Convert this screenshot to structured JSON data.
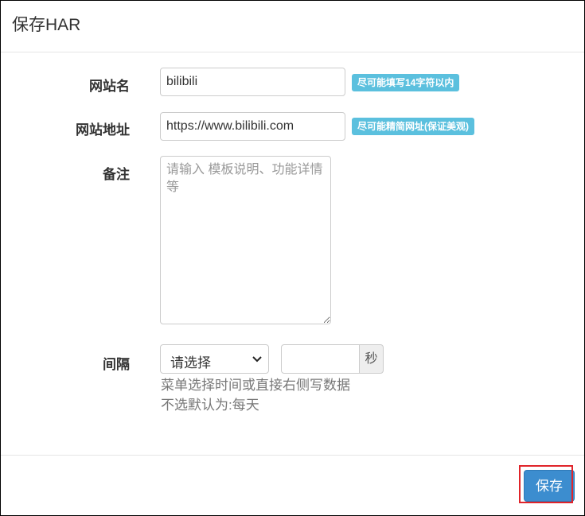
{
  "dialog": {
    "title": "保存HAR"
  },
  "form": {
    "site_name": {
      "label": "网站名",
      "value": "bilibili",
      "hint": "尽可能填写14字符以内"
    },
    "site_url": {
      "label": "网站地址",
      "value": "https://www.bilibili.com",
      "hint": "尽可能精简网址(保证美观)"
    },
    "remark": {
      "label": "备注",
      "placeholder": "请输入 模板说明、功能详情等"
    },
    "interval": {
      "label": "间隔",
      "select_value": "请选择",
      "number_value": "",
      "unit": "秒",
      "help_line1": "菜单选择时间或直接右侧写数据",
      "help_line2": "不选默认为:每天"
    }
  },
  "footer": {
    "save_label": "保存"
  },
  "colors": {
    "badge": "#5bc0de",
    "primary": "#3c8dcf",
    "highlight": "#e0242a"
  }
}
